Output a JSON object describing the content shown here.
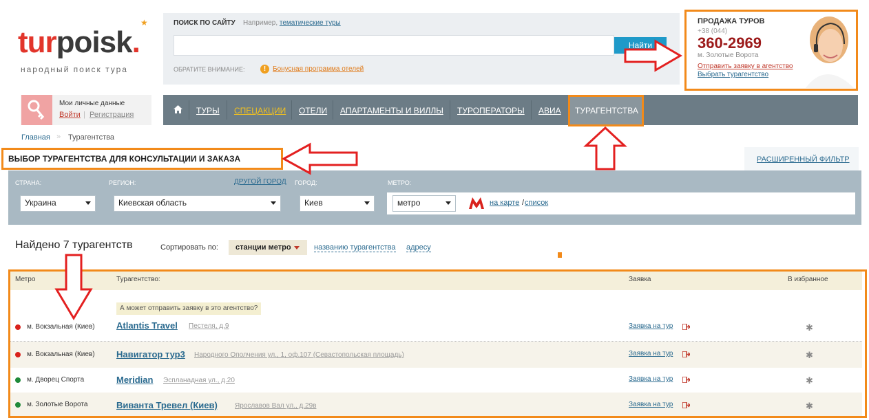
{
  "logo": {
    "part1": "tur",
    "part2": "poisk",
    "dot": ".",
    "tagline": "народный поиск тура"
  },
  "search": {
    "title": "ПОИСК ПО САЙТУ",
    "example_prefix": "Например,",
    "example_link": "тематические туры",
    "placeholder": "",
    "button": "Найти",
    "notice_label": "ОБРАТИТЕ ВНИМАНИЕ:",
    "notice_link": "Бонусная программа отелей"
  },
  "sales": {
    "title": "ПРОДАЖА ТУРОВ",
    "phone_prefix": "+38 (044)",
    "phone": "360-2969",
    "metro": "м. Золотые Ворота",
    "request_link": "Отправить заявку в агентство",
    "choose_link": "Выбрать турагентство"
  },
  "account": {
    "title": "Мои личные данные",
    "login": "Войти",
    "separator": "|",
    "register": "Регистрация"
  },
  "nav": {
    "items": [
      "ТУРЫ",
      "СПЕЦАКЦИИ",
      "ОТЕЛИ",
      "АПАРТАМЕНТЫ И ВИЛЛЫ",
      "ТУРОПЕРАТОРЫ",
      "АВИА",
      "ТУРАГЕНТСТВА"
    ],
    "highlight_color": "#f0c020"
  },
  "breadcrumb": {
    "home": "Главная",
    "separator": "»",
    "current": "Турагентства"
  },
  "heading": "ВЫБОР ТУРАГЕНТСТВА ДЛЯ КОНСУЛЬТАЦИИ И ЗАКАЗА",
  "advanced_filter": "РАСШИРЕННЫЙ ФИЛЬТР",
  "filters": {
    "country_label": "СТРАНА:",
    "country": "Украина",
    "region_label": "РЕГИОН:",
    "region": "Киевская область",
    "other_city": "ДРУГОЙ ГОРОД",
    "city_label": "ГОРОД:",
    "city": "Киев",
    "metro_label": "МЕТРО:",
    "metro": "метро",
    "map_link": "на карте",
    "slash": "/",
    "list_link": "список"
  },
  "results": {
    "found": "Найдено 7 турагентств",
    "sort_label": "Сортировать по:",
    "sort_active": "станции метро",
    "sort_name": "названию турагентства",
    "sort_address": "адресу"
  },
  "table": {
    "headers": {
      "metro": "Метро",
      "agency": "Турагентство:",
      "request": "Заявка",
      "favorite": "В избранное"
    },
    "hint": "А может отправить заявку в это агентство?",
    "rows": [
      {
        "metro": "м. Вокзальная (Киев)",
        "line_color": "#d9221c",
        "name": "Atlantis Travel",
        "address": "Пестеля, д.9",
        "request": "Заявка на тур",
        "fav": "✱"
      },
      {
        "metro": "м. Вокзальная (Киев)",
        "line_color": "#d9221c",
        "name": "Навигатор тур3",
        "address": "Народного Ополчения ул., 1, оф.107 (Севастопольская площадь)",
        "request": "Заявка на тур",
        "fav": "✱"
      },
      {
        "metro": "м. Дворец Спорта",
        "line_color": "#1f8a3a",
        "name": "Meridian",
        "address": "Эспланадная ул., д.20",
        "request": "Заявка на тур",
        "fav": "✱"
      },
      {
        "metro": "м. Золотые Ворота",
        "line_color": "#1f8a3a",
        "name": "Виванта Тревел (Киев)",
        "address": "Ярославов Вал ул., д.29в",
        "request": "Заявка на тур",
        "fav": "✱"
      }
    ]
  },
  "colors": {
    "accent_orange": "#f28a1a",
    "arrow_red": "#e32020",
    "link_blue": "#2a6a8f",
    "nav_bg": "#6c7c86"
  }
}
